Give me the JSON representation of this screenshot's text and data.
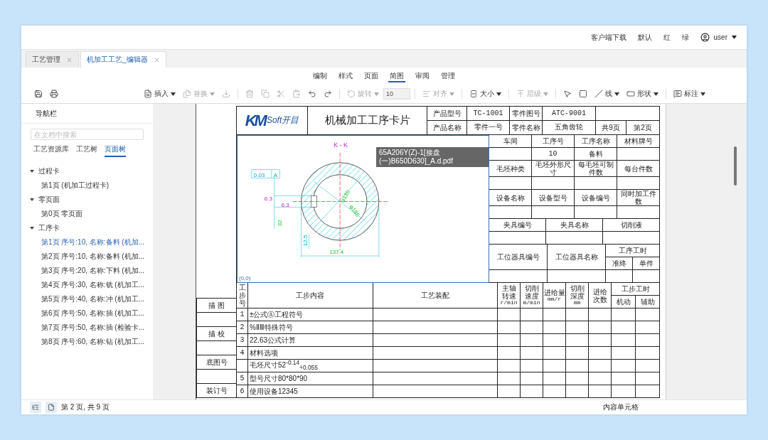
{
  "top_bar": {
    "links": [
      "客户端下载",
      "默认",
      "红",
      "绿"
    ],
    "user": "user"
  },
  "doc_tabs": [
    {
      "label": "工艺管理",
      "selected": false
    },
    {
      "label": "机加工工艺_编辑器",
      "selected": true
    }
  ],
  "ribbon_tabs": [
    {
      "label": "编制",
      "selected": false
    },
    {
      "label": "样式",
      "selected": false
    },
    {
      "label": "页面",
      "selected": false
    },
    {
      "label": "简图",
      "selected": true
    },
    {
      "label": "审阅",
      "selected": false
    },
    {
      "label": "管理",
      "selected": false
    }
  ],
  "toolbar": [
    {
      "kind": "button",
      "label": "插入",
      "menu": true,
      "disabled": false
    },
    {
      "kind": "button",
      "label": "替换",
      "menu": true,
      "disabled": true
    },
    {
      "kind": "button",
      "menu": false,
      "disabled": true
    },
    {
      "kind": "divider"
    },
    {
      "kind": "button",
      "menu": false,
      "disabled": true
    },
    {
      "kind": "button",
      "menu": false,
      "disabled": true
    },
    {
      "kind": "button",
      "menu": false,
      "disabled": true
    },
    {
      "kind": "button",
      "menu": false,
      "disabled": true
    },
    {
      "kind": "button",
      "menu": false,
      "disabled": false
    },
    {
      "kind": "button",
      "menu": false,
      "disabled": false
    },
    {
      "kind": "divider"
    },
    {
      "kind": "button",
      "label": "旋转",
      "menu": true,
      "disabled": true
    },
    {
      "kind": "input",
      "value": "10"
    },
    {
      "kind": "divider"
    },
    {
      "kind": "button",
      "label": "对齐",
      "menu": true,
      "disabled": true
    },
    {
      "kind": "divider"
    },
    {
      "kind": "button",
      "label": "大小",
      "menu": true,
      "disabled": false
    },
    {
      "kind": "divider"
    },
    {
      "kind": "button",
      "label": "层级",
      "menu": true,
      "disabled": true
    },
    {
      "kind": "divider"
    },
    {
      "kind": "button",
      "menu": false,
      "disabled": false
    },
    {
      "kind": "button",
      "menu": false,
      "disabled": false
    },
    {
      "kind": "button",
      "label": "线",
      "menu": true,
      "disabled": false
    },
    {
      "kind": "button",
      "label": "形状",
      "menu": true,
      "disabled": false
    },
    {
      "kind": "divider"
    },
    {
      "kind": "button",
      "label": "标注",
      "menu": true,
      "disabled": false
    }
  ],
  "nav": {
    "title": "导航栏",
    "search": {
      "placeholder": "在文档中搜索"
    },
    "tabs": [
      {
        "label": "工艺资源库",
        "selected": false
      },
      {
        "label": "工艺树",
        "selected": false
      },
      {
        "label": "页面树",
        "selected": true
      }
    ],
    "tree": [
      {
        "label": "过程卡",
        "expanded": true,
        "children": [
          {
            "label": "第1页 (机加工过程卡)",
            "selected": false
          }
        ]
      },
      {
        "label": "零页面",
        "expanded": true,
        "children": [
          {
            "label": "第0页 零页面",
            "selected": false
          }
        ]
      },
      {
        "label": "工序卡",
        "expanded": true,
        "children": [
          {
            "label": "第1页 序号:10, 名称:备料 (机加...",
            "selected": true
          },
          {
            "label": "第2页 序号:10, 名称:备料 (机加...",
            "selected": false
          },
          {
            "label": "第3页 序号:20, 名称:下料 (机加...",
            "selected": false
          },
          {
            "label": "第4页 序号:30, 名称:铣 (机加工...",
            "selected": false
          },
          {
            "label": "第5页 序号:40, 名称:冲 (机加工...",
            "selected": false
          },
          {
            "label": "第6页 序号:50, 名称:插 (机加工...",
            "selected": false
          },
          {
            "label": "第7页 序号:50, 名称:插 (检验卡...",
            "selected": false
          },
          {
            "label": "第8页 序号:60, 名称:钻 (机加工...",
            "selected": false
          }
        ]
      }
    ]
  },
  "card": {
    "logo": {
      "mark": "KM",
      "text": "Soft开目"
    },
    "title": "机械加工工序卡片",
    "header_row1": [
      "产品型号",
      "TC-1001",
      "零件图号",
      "ATC-9001"
    ],
    "header_row2": [
      "产品名称",
      "零件一号",
      "零件名称",
      "五角齿轮",
      "共9页",
      "第2页"
    ],
    "drawing": {
      "labels": [
        "K - K",
        "0.03",
        "A",
        "6.3",
        "6.3",
        "32",
        "φ130",
        "φ185",
        "12.5",
        "137.4"
      ],
      "origin": "(0,0)",
      "tooltip": "65A206Y(Z)-1[接盘(一)B650D630]_A.d.pdf"
    },
    "info": [
      [
        "车间",
        "工序号",
        "工序名称",
        "材料牌号"
      ],
      [
        "毛坯种类",
        "毛坯外形尺寸",
        "每毛坯可制件数",
        "每台件数"
      ],
      [
        "设备名称",
        "设备型号",
        "设备编号",
        "同时加工件数"
      ],
      [
        "夹具编号",
        "夹具名称",
        "切削液"
      ]
    ],
    "process": {
      "number": "10",
      "name": "备料"
    },
    "fixtures": {
      "labels": [
        "工位器具编号",
        "工位器具名称"
      ],
      "time_label": "工序工时",
      "time_columns": [
        "准终",
        "单件"
      ]
    },
    "steps": {
      "columns": [
        {
          "label": "工步号"
        },
        {
          "label": "工步内容"
        },
        {
          "label": "工艺装配"
        },
        {
          "label": "主轴转速",
          "unit": "r/min"
        },
        {
          "label": "切削速度",
          "unit": "m/min"
        },
        {
          "label": "进给量",
          "unit": "mm/r"
        },
        {
          "label": "切削深度",
          "unit": "mm"
        },
        {
          "label": "进给次数"
        }
      ],
      "time_label": "工步工时",
      "time_columns": [
        "机动",
        "辅助"
      ],
      "rows": [
        {
          "no": "1",
          "content": "±公式Ⓐ工程符号"
        },
        {
          "no": "2",
          "content": "%ⅡⅢ特殊符号"
        },
        {
          "no": "3",
          "content": "22.63公式计算"
        },
        {
          "no": "4",
          "content": "材料选项"
        },
        {
          "content": "毛坯尺寸52$^{-0.14}$$_{+0.055}$"
        },
        {
          "no": "5",
          "content": "型号尺寸80*80*90"
        },
        {
          "no": "6",
          "content": "使用设备12345"
        }
      ]
    },
    "signatures": [
      "描 图",
      "描 校",
      "底图号",
      "装订号"
    ]
  },
  "status_bar": {
    "page": "第 2 页, 共 9 页",
    "cell": "内容单元格"
  }
}
